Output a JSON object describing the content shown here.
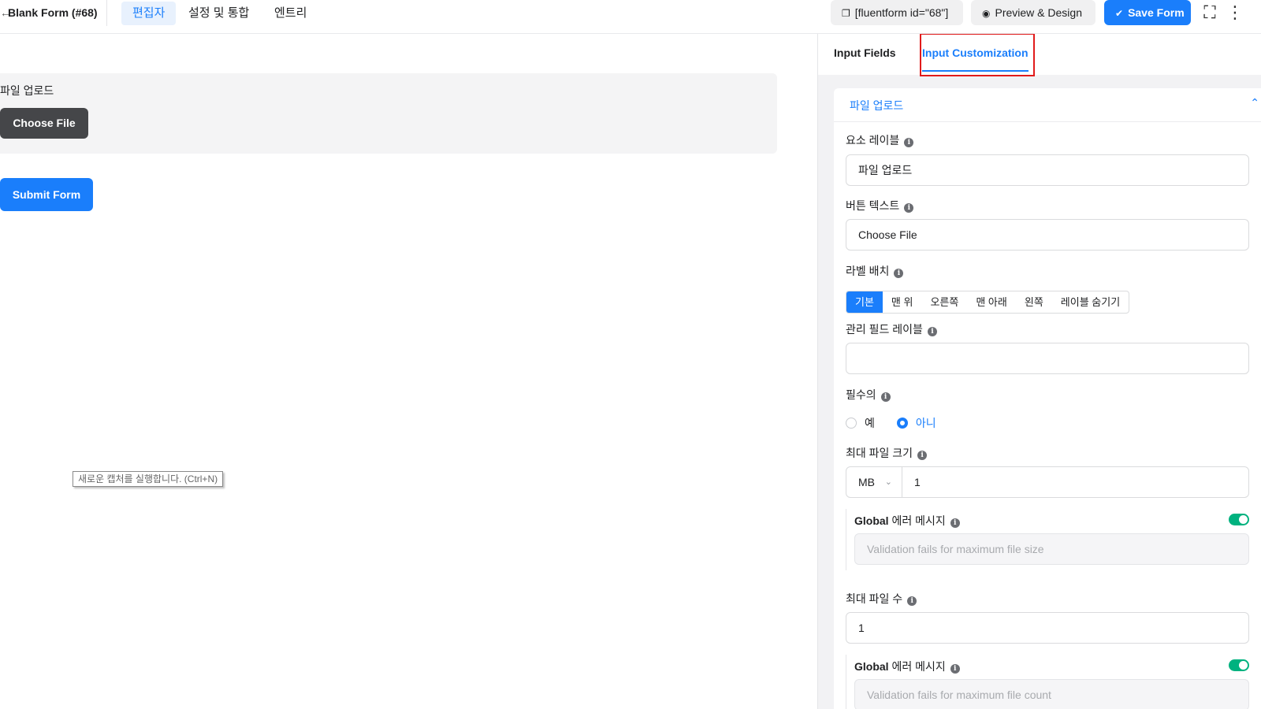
{
  "topbar": {
    "form_title": "Blank Form (#68)",
    "tabs": [
      {
        "label": "편집자",
        "active": true
      },
      {
        "label": "설정 및 통합",
        "active": false
      },
      {
        "label": "엔트리",
        "active": false
      }
    ],
    "shortcode_label": "[fluentform id=\"68\"]",
    "preview_label": "Preview & Design",
    "save_label": "Save Form"
  },
  "canvas": {
    "field_label": "파일 업로드",
    "choose_file_label": "Choose File",
    "submit_label": "Submit Form",
    "tooltip": "새로운 캡처를 실행합니다. (Ctrl+N)"
  },
  "panel": {
    "tabs": [
      {
        "label": "Input Fields",
        "active": false
      },
      {
        "label": "Input Customization",
        "active": true
      }
    ],
    "section_title": "파일 업로드",
    "element_label": {
      "label": "요소 레이블",
      "value": "파일 업로드"
    },
    "button_text": {
      "label": "버튼 텍스트",
      "value": "Choose File"
    },
    "label_placement": {
      "label": "라벨 배치",
      "options": [
        "기본",
        "맨 위",
        "오른쪽",
        "맨 아래",
        "왼쪽",
        "레이블 숨기기"
      ],
      "selected": "기본"
    },
    "admin_field_label": {
      "label": "관리 필드 레이블",
      "value": ""
    },
    "required": {
      "label": "필수의",
      "options": [
        "예",
        "아니"
      ],
      "selected": "아니"
    },
    "max_file_size": {
      "label": "최대 파일 크기",
      "unit": "MB",
      "value": "1",
      "global_error": {
        "label_bold": "Global",
        "label_rest": "에러 메시지",
        "enabled": true,
        "placeholder": "Validation fails for maximum file size"
      }
    },
    "max_file_count": {
      "label": "최대 파일 수",
      "value": "1",
      "global_error": {
        "label_bold": "Global",
        "label_rest": "에러 메시지",
        "enabled": true,
        "placeholder": "Validation fails for maximum file count"
      }
    }
  },
  "colors": {
    "primary": "#1a7efb",
    "toggle_on": "#00b27f",
    "highlight": "#e11b1b",
    "dark_button": "#454649"
  }
}
